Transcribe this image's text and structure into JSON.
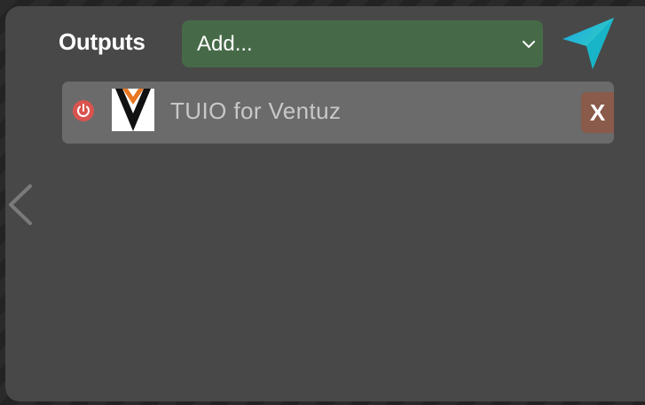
{
  "header": {
    "title": "Outputs",
    "add_select": {
      "value": "Add...",
      "chevron_icon": "chevron-down-icon"
    },
    "send_icon": "send-icon"
  },
  "outputs": [
    {
      "name": "TUIO for Ventuz",
      "power_icon": "power-icon",
      "logo_icon": "ventuz-logo",
      "remove_label": "X"
    }
  ],
  "nav": {
    "back_icon": "chevron-left-icon"
  },
  "colors": {
    "panel": "#484848",
    "select_bg": "#466a48",
    "row_bg": "#6b6b6b",
    "remove_bg": "#8a5a4a",
    "power": "#d9534f",
    "send_gradient_start": "#1aa3e8",
    "send_gradient_end": "#39e0b0"
  }
}
